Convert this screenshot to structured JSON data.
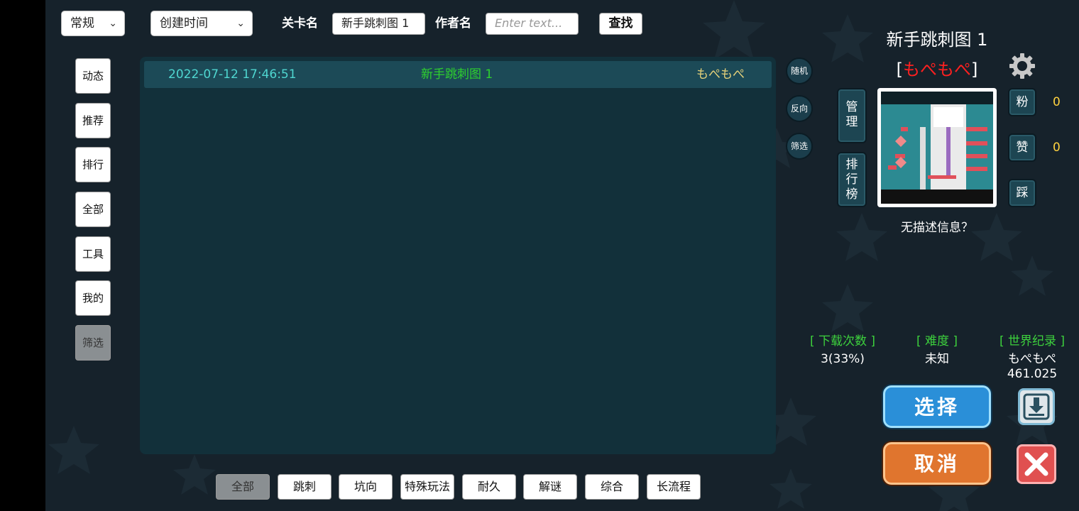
{
  "topbar": {
    "sort_mode": "常规",
    "sort_field": "创建时间",
    "level_name_label": "关卡名",
    "level_name_value": "新手跳刺图 1",
    "author_label": "作者名",
    "author_placeholder": "Enter text...",
    "search_button": "查找"
  },
  "sidebar": {
    "items": [
      {
        "label": "动态"
      },
      {
        "label": "推荐"
      },
      {
        "label": "排行"
      },
      {
        "label": "全部"
      },
      {
        "label": "工具"
      },
      {
        "label": "我的"
      },
      {
        "label": "筛选",
        "active": true
      }
    ]
  },
  "level_list": {
    "rows": [
      {
        "date": "2022-07-12 17:46:51",
        "name": "新手跳刺图 1",
        "author": "もぺもぺ"
      }
    ]
  },
  "side_circles": [
    "随机",
    "反向",
    "筛选"
  ],
  "detail": {
    "title": "新手跳刺图 1",
    "author_bracket_open": "[",
    "author": "もぺもぺ",
    "author_bracket_close": "]",
    "manage_button": "管\n理",
    "leaderboard_button": "排\n行\n榜",
    "fans_button": "粉",
    "fans_count": "0",
    "like_button": "赞",
    "like_count": "0",
    "dislike_button": "踩",
    "description": "无描述信息？",
    "stats": {
      "downloads_label": "[ 下载次数 ]",
      "downloads_value": "3(33%)",
      "difficulty_label": "[ 难度 ]",
      "difficulty_value": "未知",
      "record_label": "[ 世界纪录 ]",
      "record_holder": "もぺもぺ",
      "record_time": "461.025"
    },
    "select_button": "选择",
    "cancel_button": "取消"
  },
  "filters": [
    {
      "label": "全部",
      "active": true
    },
    {
      "label": "跳刺"
    },
    {
      "label": "坑向"
    },
    {
      "label": "特殊玩法"
    },
    {
      "label": "耐久"
    },
    {
      "label": "解谜"
    },
    {
      "label": "综合"
    },
    {
      "label": "长流程"
    }
  ],
  "colors": {
    "background": "#16222b",
    "list_panel": "#12303a",
    "row_date": "#4fd6d0",
    "row_name": "#2ed12e",
    "row_author": "#e6d27a",
    "author_red": "#ff2020",
    "stat_green": "#3dd13d",
    "count_yellow": "#ffd23f",
    "select_blue": "#2a8fd8",
    "cancel_orange": "#e0752e",
    "close_red": "#e05050"
  }
}
